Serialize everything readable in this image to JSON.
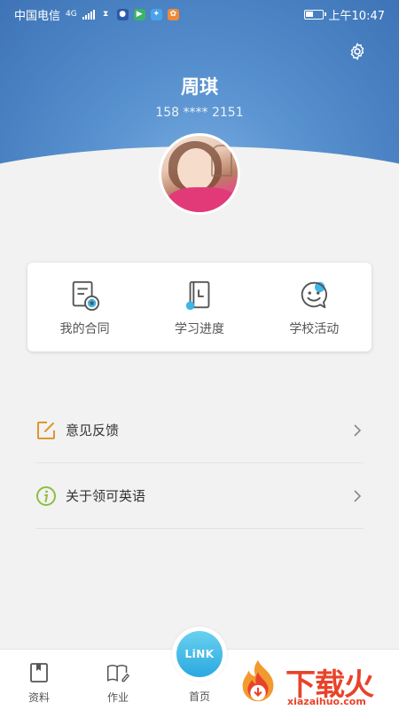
{
  "status_bar": {
    "carrier": "中国电信",
    "network": "4G",
    "time": "上午10:47"
  },
  "colors": {
    "header_blue": "#4a82c3",
    "accent_cyan": "#3fb6e6",
    "feedback_orange": "#e0962c",
    "about_green": "#8cbf3f",
    "watermark_red": "#e8432a"
  },
  "header": {
    "settings_icon": "gear-icon"
  },
  "profile": {
    "name": "周琪",
    "phone": "158 **** 2151"
  },
  "quick_actions": [
    {
      "label": "我的合同",
      "icon": "contract-icon"
    },
    {
      "label": "学习进度",
      "icon": "study-progress-icon"
    },
    {
      "label": "学校活动",
      "icon": "school-activity-icon"
    }
  ],
  "menu": [
    {
      "label": "意见反馈",
      "icon": "feedback-edit-icon"
    },
    {
      "label": "关于领可英语",
      "icon": "info-icon"
    }
  ],
  "bottom_nav": {
    "materials": "资料",
    "homework": "作业",
    "home": "首页",
    "home_button_text": "LiNK"
  },
  "watermark": {
    "title": "下载火",
    "url": "xiazaihuo.com"
  }
}
